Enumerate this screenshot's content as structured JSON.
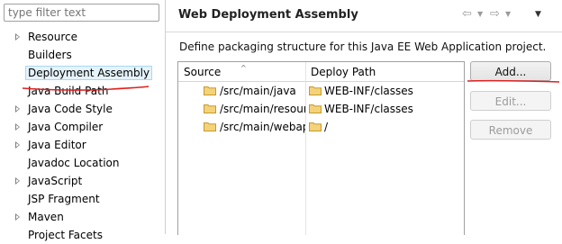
{
  "filter": {
    "placeholder": "type filter text"
  },
  "tree": {
    "items": [
      {
        "label": "Resource",
        "expandable": true
      },
      {
        "label": "Builders",
        "expandable": false
      },
      {
        "label": "Deployment Assembly",
        "expandable": false,
        "selected": true
      },
      {
        "label": "Java Build Path",
        "expandable": false
      },
      {
        "label": "Java Code Style",
        "expandable": true
      },
      {
        "label": "Java Compiler",
        "expandable": true
      },
      {
        "label": "Java Editor",
        "expandable": true
      },
      {
        "label": "Javadoc Location",
        "expandable": false
      },
      {
        "label": "JavaScript",
        "expandable": true
      },
      {
        "label": "JSP Fragment",
        "expandable": false
      },
      {
        "label": "Maven",
        "expandable": true
      },
      {
        "label": "Project Facets",
        "expandable": false
      }
    ]
  },
  "header": {
    "title": "Web Deployment Assembly",
    "nav_back_icon": "back-arrow-icon",
    "nav_forward_icon": "forward-arrow-icon",
    "view_menu_icon": "view-menu-icon"
  },
  "main": {
    "description": "Define packaging structure for this Java EE Web Application project.",
    "table": {
      "columns": [
        "Source",
        "Deploy Path"
      ],
      "rows": [
        {
          "source": "/src/main/java",
          "deploy": "WEB-INF/classes"
        },
        {
          "source": "/src/main/resources",
          "deploy": "WEB-INF/classes"
        },
        {
          "source": "/src/main/webapp",
          "deploy": "/"
        }
      ]
    },
    "buttons": {
      "add": "Add...",
      "edit": "Edit...",
      "remove": "Remove"
    }
  },
  "colors": {
    "annotation": "#e02020",
    "selection_bg": "#e5f3fb",
    "folder": "#e8c464"
  }
}
